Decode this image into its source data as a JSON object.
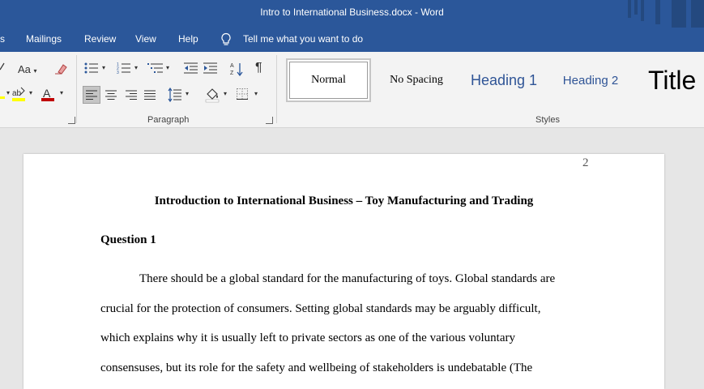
{
  "window": {
    "title": "Intro to International Business.docx  -  Word"
  },
  "tabs": [
    {
      "label": "s"
    },
    {
      "label": "Mailings"
    },
    {
      "label": "Review"
    },
    {
      "label": "View"
    },
    {
      "label": "Help"
    }
  ],
  "tell_me": "Tell me what you want to do",
  "ribbon": {
    "paragraph_label": "Paragraph",
    "styles_label": "Styles",
    "styles": {
      "normal": "Normal",
      "no_spacing": "No Spacing",
      "heading1": "Heading 1",
      "heading2": "Heading 2",
      "title": "Title"
    },
    "font_size_glyph": "Aa"
  },
  "document": {
    "page_number": "2",
    "title": "Introduction to International Business – Toy Manufacturing and Trading",
    "heading": "Question 1",
    "lines": [
      "There should be a global standard for the manufacturing of toys. Global standards are",
      "crucial for the protection of consumers. Setting global standards may be arguably difficult,",
      "which explains why it is usually left to private sectors as one of the various voluntary",
      "consensuses, but its role for the safety and wellbeing of stakeholders is undebatable (The"
    ]
  },
  "colors": {
    "accent": "#2b579a",
    "heading_blue": "#2f5496",
    "font_color_red": "#c00000"
  }
}
